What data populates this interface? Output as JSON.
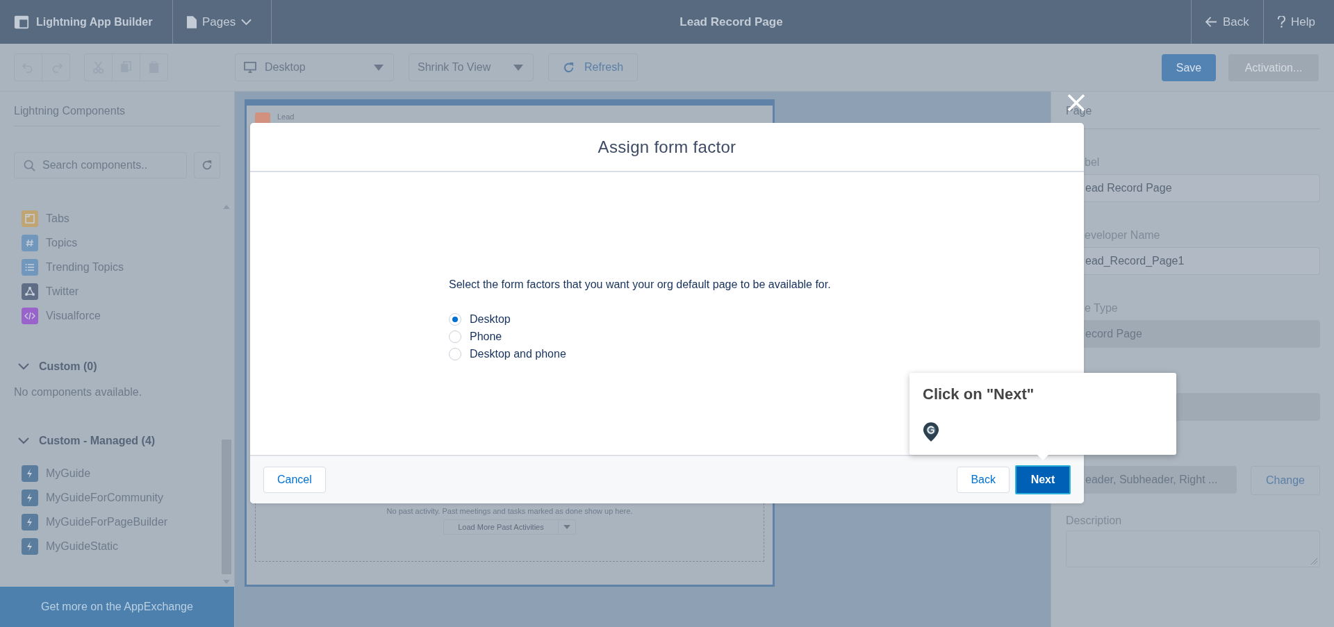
{
  "top_bar": {
    "app_title": "Lightning App Builder",
    "pages_menu": "Pages",
    "page_title": "Lead Record Page",
    "back": "Back",
    "help": "Help"
  },
  "toolbar": {
    "device": "Desktop",
    "zoom": "Shrink To View",
    "refresh": "Refresh",
    "save": "Save",
    "activation": {
      "label": "Activation...",
      "disabled": true
    }
  },
  "sidebar": {
    "title": "Lightning Components",
    "search": {
      "placeholder": "Search components.."
    },
    "standard_items": [
      {
        "label": "Tabs",
        "kind": "tabs",
        "color": "#c0a472"
      },
      {
        "label": "Topics",
        "kind": "hash",
        "color": "#7197bd"
      },
      {
        "label": "Trending Topics",
        "kind": "list",
        "color": "#7197bd"
      },
      {
        "label": "Twitter",
        "kind": "network",
        "color": "#5f6e86"
      },
      {
        "label": "Visualforce",
        "kind": "code",
        "color": "#9a63cc"
      }
    ],
    "sections": [
      {
        "title": "Custom (0)",
        "expanded": true,
        "empty_text": "No components available."
      },
      {
        "title": "Custom - Managed (4)",
        "expanded": true,
        "items": [
          {
            "label": "MyGuide",
            "kind": "bolt",
            "color": "#5b7d9d"
          },
          {
            "label": "MyGuideForCommunity",
            "kind": "bolt",
            "color": "#5b7d9d"
          },
          {
            "label": "MyGuideForPageBuilder",
            "kind": "bolt",
            "color": "#5b7d9d"
          },
          {
            "label": "MyGuideStatic",
            "kind": "bolt",
            "color": "#5b7d9d"
          }
        ]
      }
    ],
    "appexchange": "Get more on the AppExchange"
  },
  "canvas": {
    "record_label": "Lead",
    "activity_text": "No past activity. Past meetings and tasks marked as done show up here.",
    "load_more": "Load More Past Activities"
  },
  "properties": {
    "title": "Page",
    "fields": [
      {
        "label": "bel",
        "value": "ead Record Page",
        "disabled": false
      },
      {
        "label": "eveloper Name",
        "value": "ead_Record_Page1",
        "disabled": false
      },
      {
        "label": "e Type",
        "value": "ecord Page",
        "disabled": true
      },
      {
        "disabled": true
      },
      {
        "value": "eader, Subheader, Right ...",
        "disabled": true,
        "button": "Change"
      }
    ],
    "description": {
      "label": "Description"
    }
  },
  "modal": {
    "title": "Assign form factor",
    "prompt": "Select the form factors that you want your org default page to be available for.",
    "options": [
      {
        "label": "Desktop",
        "selected": true
      },
      {
        "label": "Phone",
        "selected": false
      },
      {
        "label": "Desktop and phone",
        "selected": false
      }
    ],
    "cancel": "Cancel",
    "back": "Back",
    "next": "Next"
  },
  "tooltip": {
    "text": "Click on \"Next\""
  }
}
